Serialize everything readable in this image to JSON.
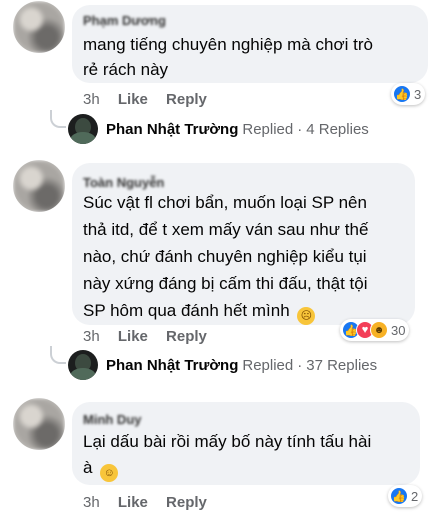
{
  "comments": [
    {
      "author": "Phạm Dương",
      "lines": [
        "mang tiếng chuyên nghiệp mà chơi trò",
        "rẻ rách này"
      ],
      "time": "3h",
      "like_label": "Like",
      "reply_label": "Reply",
      "reaction_count": "3",
      "reply_thread": {
        "name": "Phan Nhật Trường",
        "verb": "Replied",
        "separator": "·",
        "count": "4 Replies"
      }
    },
    {
      "author": "Toàn Nguyễn",
      "lines": [
        "Súc vật fl chơi bẩn, muốn loại SP nên",
        "thả itd, để t xem mấy ván sau như thế",
        "nào, chứ đánh chuyên nghiệp kiểu tụi",
        "này xứng đáng bị cấm thi đấu, thật tội",
        "SP hôm qua đánh hết mình"
      ],
      "time": "3h",
      "like_label": "Like",
      "reply_label": "Reply",
      "reaction_count": "30",
      "reply_thread": {
        "name": "Phan Nhật Trường",
        "verb": "Replied",
        "separator": "·",
        "count": "37 Replies"
      }
    },
    {
      "author": "Minh Duy",
      "lines": [
        "Lại dấu bài rồi mấy bố này tính tấu hài",
        "à"
      ],
      "time": "3h",
      "like_label": "Like",
      "reply_label": "Reply",
      "reaction_count": "2"
    }
  ],
  "icons": {
    "like": "thumbs-up-icon",
    "love": "heart-icon",
    "haha": "laughing-emoji-icon",
    "sad_emoji": "disappointed-face-emoji",
    "rofl_emoji": "rolling-on-floor-laughing-emoji"
  },
  "colors": {
    "bubble": "#f0f2f5",
    "like_blue": "#1877f2",
    "love_red": "#f33e58",
    "meta_gray": "#65676b"
  }
}
